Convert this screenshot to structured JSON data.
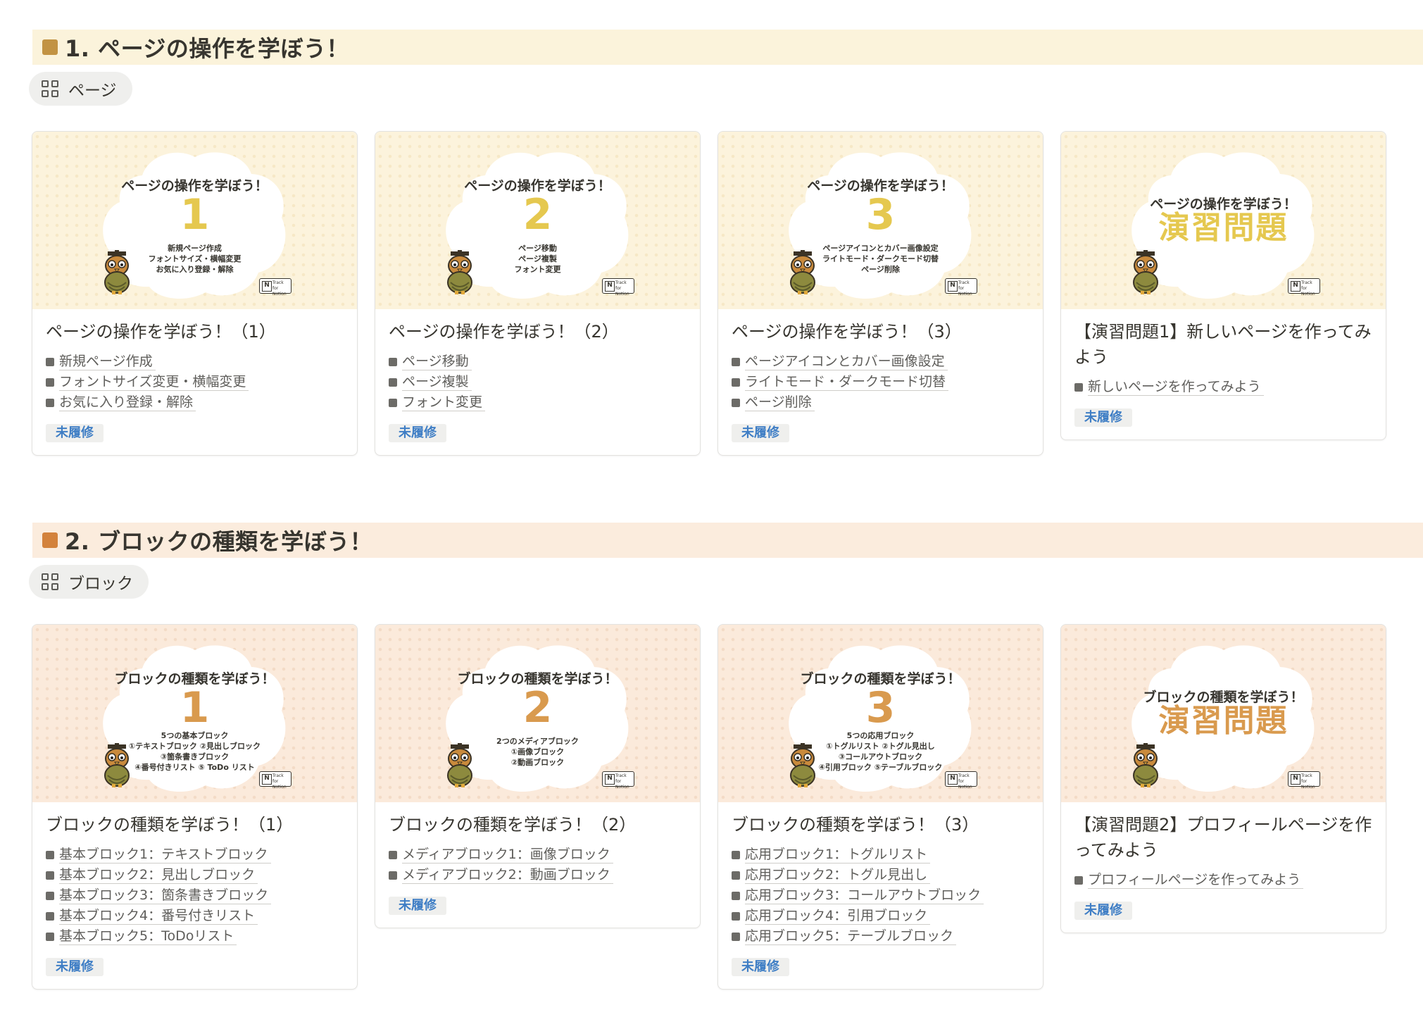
{
  "sections": [
    {
      "heading": "1. ページの操作を学ぼう！",
      "square_color": "#c29343",
      "view_label": "ページ",
      "cards": [
        {
          "cover_title": "ページの操作を学ぼう！",
          "cover_num": "1",
          "cover_sub": [
            "新規ページ作成",
            "フォントサイズ・横幅変更",
            "お気に入り登録・解除"
          ],
          "title": "ページの操作を学ぼう！（1）",
          "items": [
            "新規ページ作成",
            "フォントサイズ変更・横幅変更",
            "お気に入り登録・解除"
          ],
          "status": "未履修"
        },
        {
          "cover_title": "ページの操作を学ぼう！",
          "cover_num": "2",
          "cover_sub": [
            "ページ移動",
            "ページ複製",
            "フォント変更"
          ],
          "title": "ページの操作を学ぼう！（2）",
          "items": [
            "ページ移動",
            "ページ複製",
            "フォント変更"
          ],
          "status": "未履修"
        },
        {
          "cover_title": "ページの操作を学ぼう！",
          "cover_num": "3",
          "cover_sub": [
            "ページアイコンとカバー画像設定",
            "ライトモード・ダークモード切替",
            "ページ削除"
          ],
          "title": "ページの操作を学ぼう！（3）",
          "items": [
            "ページアイコンとカバー画像設定",
            "ライトモード・ダークモード切替",
            "ページ削除"
          ],
          "status": "未履修"
        },
        {
          "cover_title": "ページの操作を学ぼう！",
          "cover_ex": "演習問題",
          "title": "【演習問題1】新しいページを作ってみよう",
          "items": [
            "新しいページを作ってみよう"
          ],
          "status": "未履修"
        }
      ]
    },
    {
      "heading": "2. ブロックの種類を学ぼう！",
      "square_color": "#d3823c",
      "view_label": "ブロック",
      "cards": [
        {
          "cover_title": "ブロックの種類を学ぼう！",
          "cover_num": "1",
          "cover_sub": [
            "5つの基本ブロック",
            "①テキストブロック ②見出しブロック",
            "③箇条書きブロック",
            "④番号付きリスト ⑤ ToDo リスト"
          ],
          "title": "ブロックの種類を学ぼう！（1）",
          "items": [
            "基本ブロック1：テキストブロック",
            "基本ブロック2：見出しブロック",
            "基本ブロック3：箇条書きブロック",
            "基本ブロック4：番号付きリスト",
            "基本ブロック5：ToDoリスト"
          ],
          "status": "未履修"
        },
        {
          "cover_title": "ブロックの種類を学ぼう！",
          "cover_num": "2",
          "cover_sub": [
            "2つのメディアブロック",
            "①画像ブロック",
            "②動画ブロック"
          ],
          "title": "ブロックの種類を学ぼう！（2）",
          "items": [
            "メディアブロック1：画像ブロック",
            "メディアブロック2：動画ブロック"
          ],
          "status": "未履修"
        },
        {
          "cover_title": "ブロックの種類を学ぼう！",
          "cover_num": "3",
          "cover_sub": [
            "5つの応用ブロック",
            "①トグルリスト ②トグル見出し",
            "③コールアウトブロック",
            "④引用ブロック ⑤テーブルブロック"
          ],
          "title": "ブロックの種類を学ぼう！（3）",
          "items": [
            "応用ブロック1：トグルリスト",
            "応用ブロック2：トグル見出し",
            "応用ブロック3：コールアウトブロック",
            "応用ブロック4：引用ブロック",
            "応用ブロック5：テーブルブロック"
          ],
          "status": "未履修"
        },
        {
          "cover_title": "ブロックの種類を学ぼう！",
          "cover_ex": "演習問題",
          "title": "【演習問題2】プロフィールページを作ってみよう",
          "items": [
            "プロフィールページを作ってみよう"
          ],
          "status": "未履修"
        }
      ]
    }
  ],
  "badge_text": "Track for Notion"
}
